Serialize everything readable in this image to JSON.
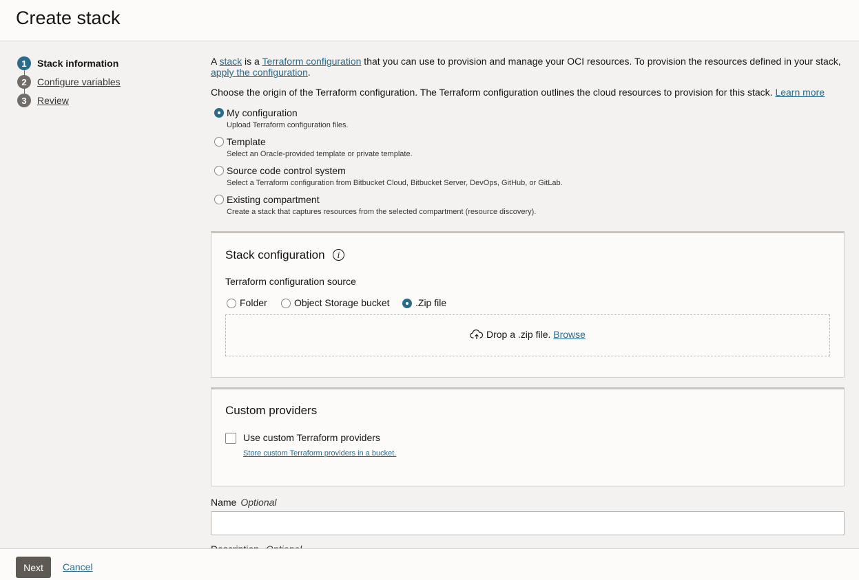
{
  "header": {
    "title": "Create stack"
  },
  "steps": [
    {
      "number": "1",
      "label": "Stack information"
    },
    {
      "number": "2",
      "label": "Configure variables"
    },
    {
      "number": "3",
      "label": "Review"
    }
  ],
  "intro": {
    "part1": "A ",
    "link_stack": "stack",
    "part2": " is a ",
    "link_terraform": "Terraform configuration",
    "part3": " that you can use to provision and manage your OCI resources. To provision the resources defined in your stack, ",
    "link_apply": "apply the configuration",
    "part4": "."
  },
  "origin": {
    "text": "Choose the origin of the Terraform configuration. The Terraform configuration outlines the cloud resources to provision for this stack. ",
    "learn_more": "Learn more",
    "options": [
      {
        "label": "My configuration",
        "description": "Upload Terraform configuration files.",
        "selected": true
      },
      {
        "label": "Template",
        "description": "Select an Oracle-provided template or private template.",
        "selected": false
      },
      {
        "label": "Source code control system",
        "description": "Select a Terraform configuration from Bitbucket Cloud, Bitbucket Server, DevOps, GitHub, or GitLab.",
        "selected": false
      },
      {
        "label": "Existing compartment",
        "description": "Create a stack that captures resources from the selected compartment (resource discovery).",
        "selected": false
      }
    ]
  },
  "stack_config": {
    "title": "Stack configuration",
    "info_icon": "info-icon",
    "source_label": "Terraform configuration source",
    "sources": [
      {
        "label": "Folder",
        "selected": false
      },
      {
        "label": "Object Storage bucket",
        "selected": false
      },
      {
        "label": ".Zip file",
        "selected": true
      }
    ],
    "drop_text": "Drop a .zip file. ",
    "browse": "Browse",
    "upload_icon": "cloud-upload-icon"
  },
  "custom_providers": {
    "title": "Custom providers",
    "checkbox_label": "Use custom Terraform providers",
    "checked": false,
    "link": "Store custom Terraform providers in a bucket."
  },
  "name_field": {
    "label": "Name",
    "optional": "Optional",
    "value": ""
  },
  "description_field": {
    "label": "Description",
    "optional": "Optional"
  },
  "footer": {
    "next": "Next",
    "cancel": "Cancel"
  },
  "colors": {
    "accent": "#2b6b8a",
    "button": "#5f5954",
    "page_bg": "#f3f2f1"
  }
}
